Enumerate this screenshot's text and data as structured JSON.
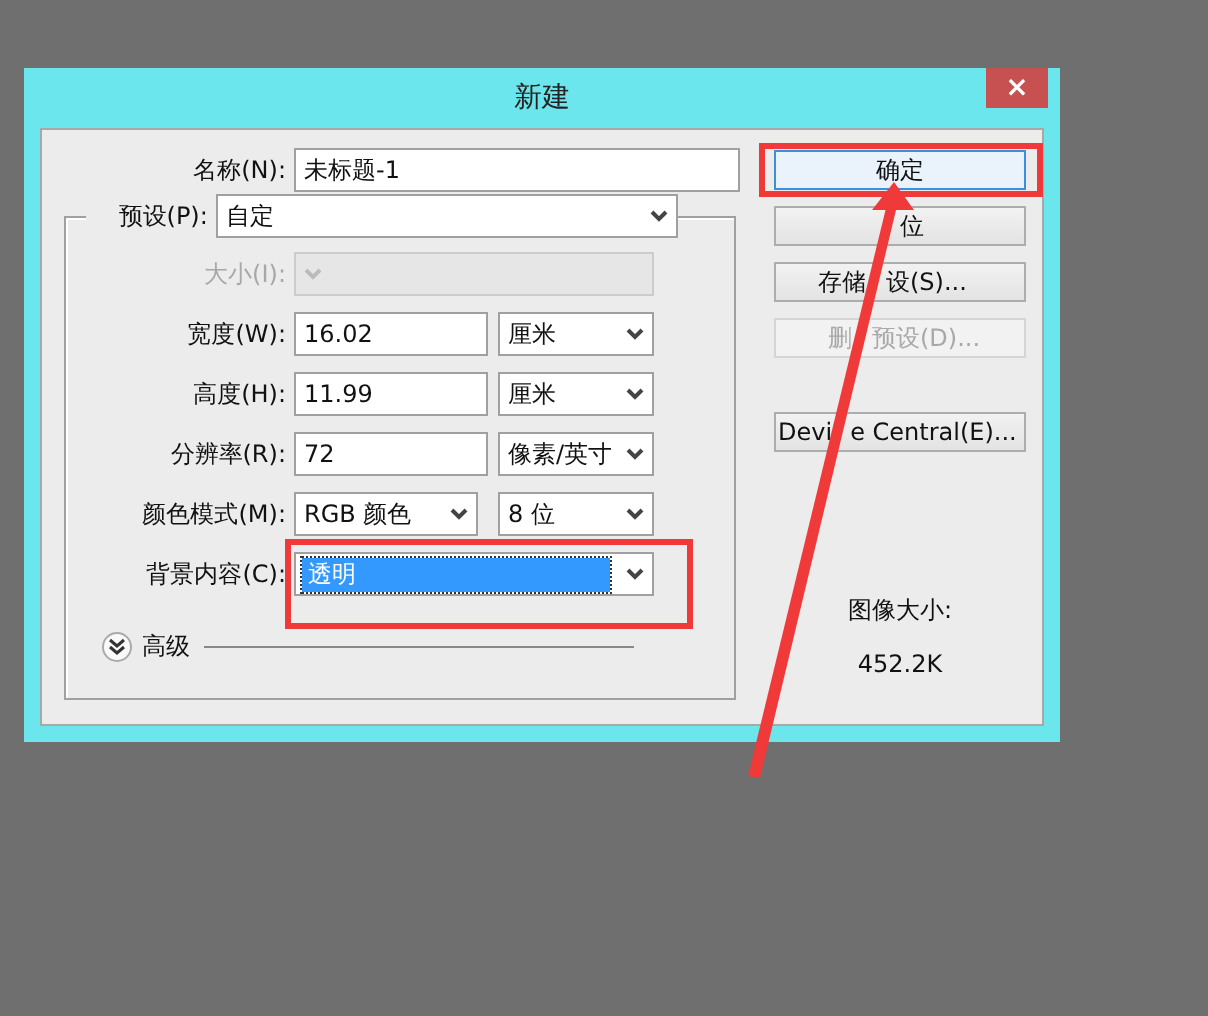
{
  "window": {
    "title": "新建",
    "close": "×"
  },
  "name_field": {
    "label": "名称(N):",
    "value": "未标题-1"
  },
  "preset": {
    "label": "预设(P):",
    "value": "自定"
  },
  "fields": [
    {
      "kind": "select",
      "label": "大小(I):",
      "disabled": true,
      "highlighted": false
    },
    {
      "kind": "text",
      "label": "宽度(W):",
      "value": "16.02",
      "unit": "厘米",
      "disabled": false,
      "highlighted": false
    },
    {
      "kind": "text",
      "label": "高度(H):",
      "value": "11.99",
      "unit": "厘米",
      "disabled": false,
      "highlighted": false
    },
    {
      "kind": "text",
      "label": "分辨率(R):",
      "value": "72",
      "unit": "像素/英寸",
      "disabled": false,
      "highlighted": false
    },
    {
      "kind": "select",
      "label": "颜色模式(M):",
      "value": "RGB 颜色",
      "unit": "8 位",
      "disabled": false,
      "highlighted": false
    },
    {
      "kind": "select",
      "label": "背景内容(C):",
      "value": "透明",
      "disabled": false,
      "highlighted": true
    }
  ],
  "advanced": {
    "label": "高级",
    "expanded": false
  },
  "buttons": [
    {
      "label": [
        "确定"
      ],
      "default": true,
      "disabled": false
    },
    {
      "label": [
        "位"
      ],
      "default": false,
      "disabled": false
    },
    {
      "label": [
        "存储",
        "设(S)..."
      ],
      "default": false,
      "disabled": false
    },
    {
      "label": [
        "删",
        "预设(D)..."
      ],
      "default": false,
      "disabled": true
    },
    {
      "label": [
        "Devi",
        "e Central(E)..."
      ],
      "default": false,
      "disabled": false
    }
  ],
  "image_size": {
    "label": "图像大小:",
    "value": "452.2K"
  }
}
